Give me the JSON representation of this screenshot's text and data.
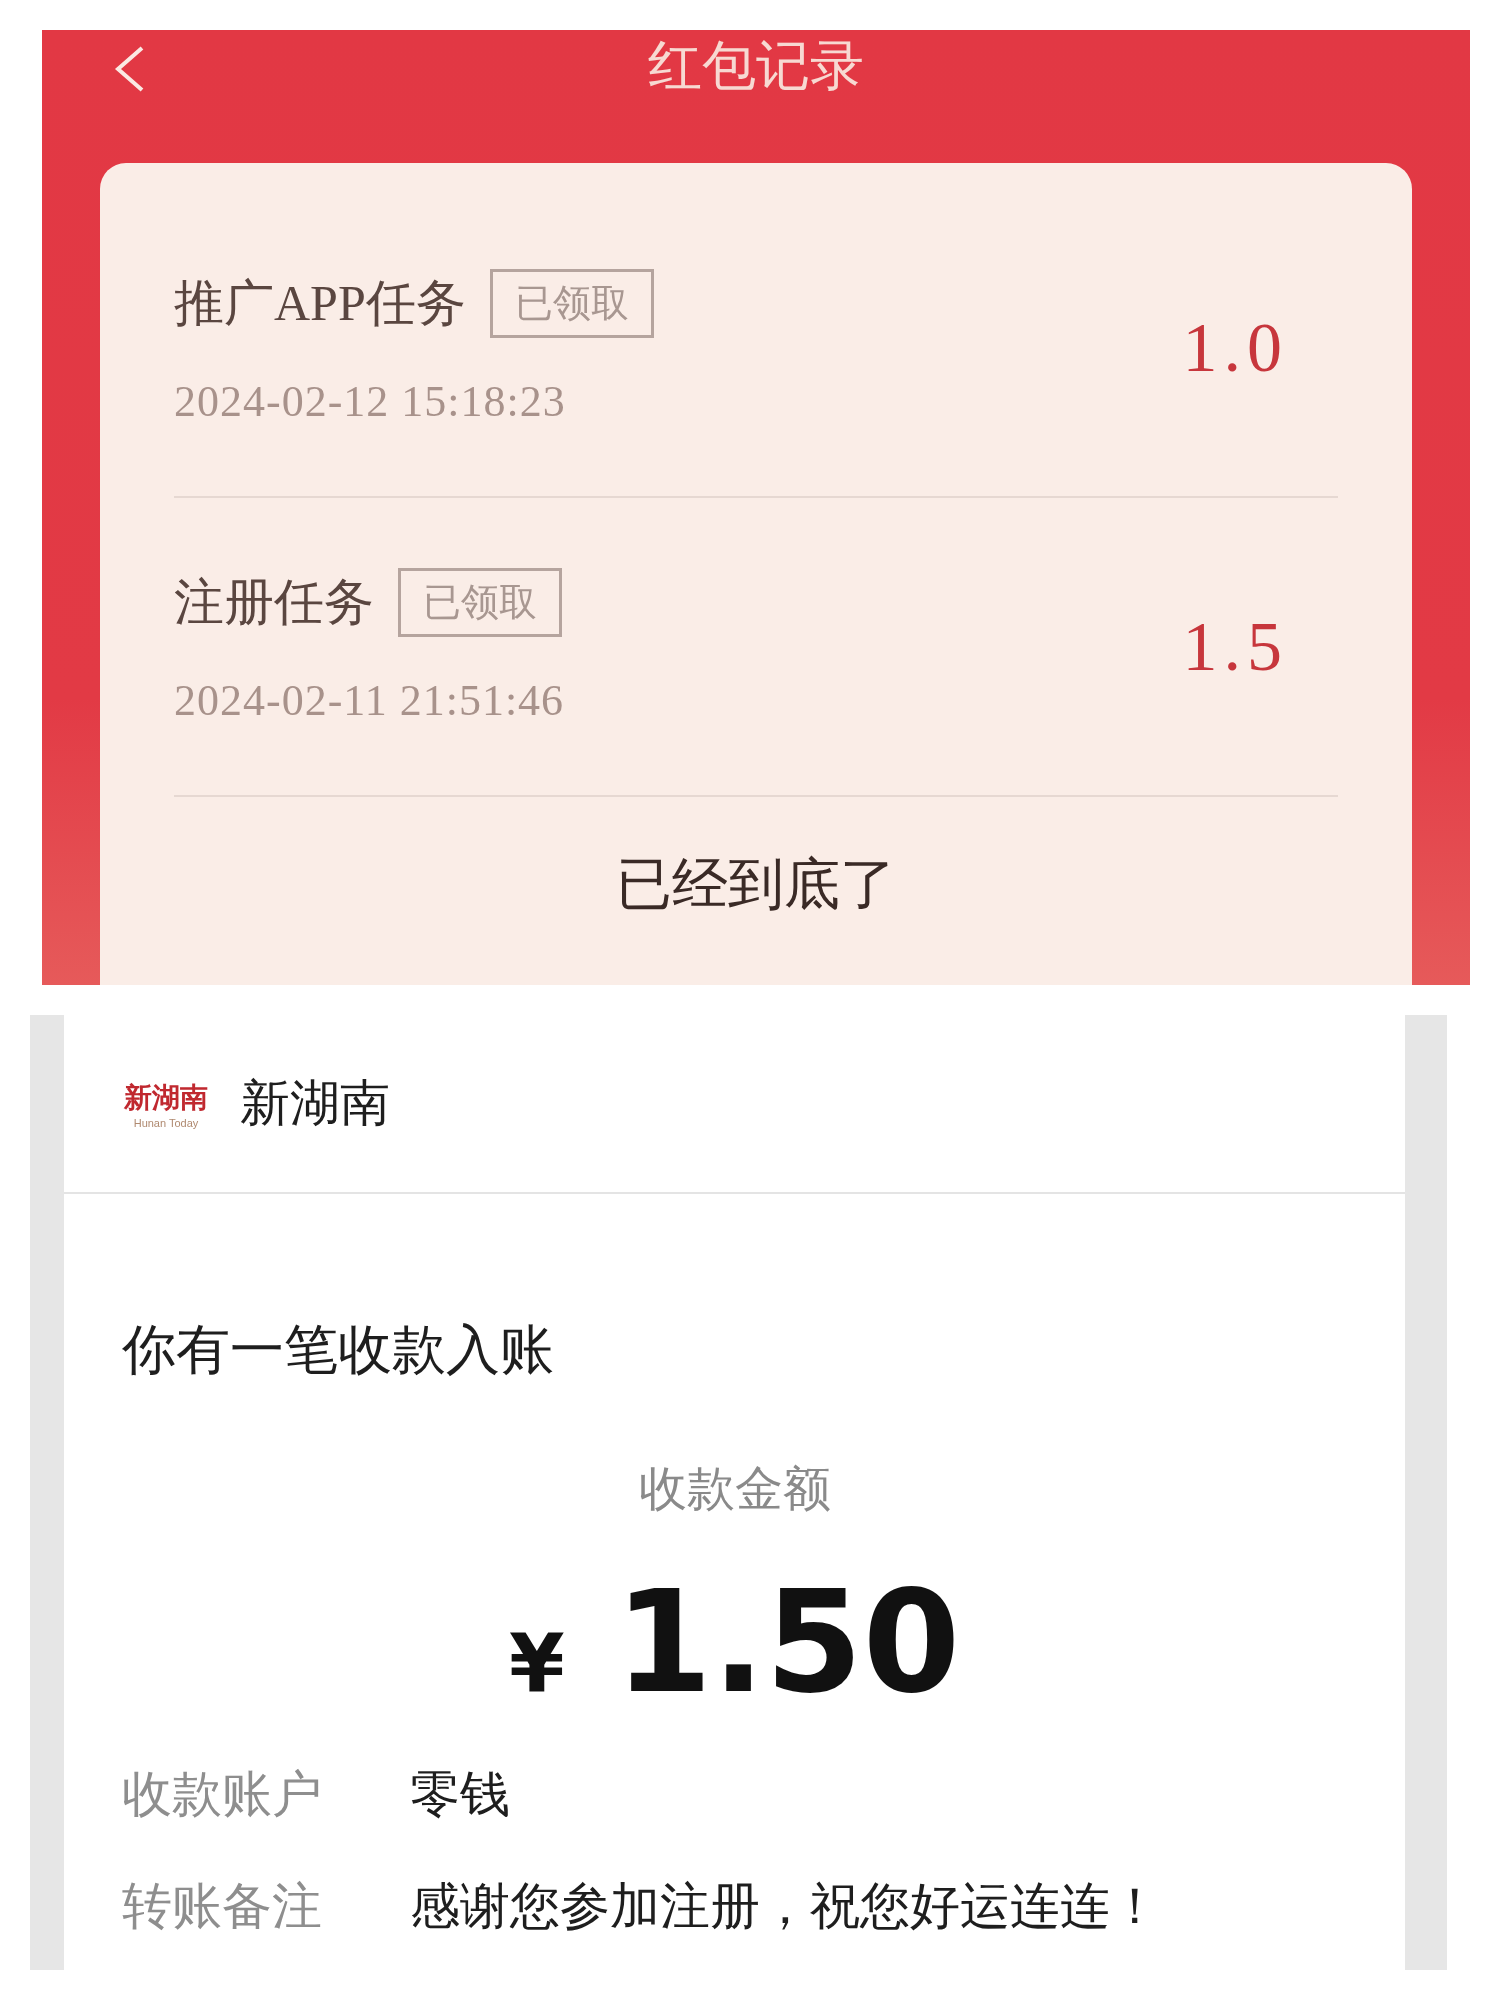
{
  "record_screen": {
    "title": "红包记录",
    "records": [
      {
        "task": "推广APP任务",
        "status": "已领取",
        "time": "2024-02-12  15:18:23",
        "amount": "1.0"
      },
      {
        "task": "注册任务",
        "status": "已领取",
        "time": "2024-02-11  21:51:46",
        "amount": "1.5"
      }
    ],
    "end_note": "已经到底了"
  },
  "payment_notice": {
    "logo_text": "新湖南",
    "logo_subtext": "Hunan Today",
    "sender": "新湖南",
    "headline": "你有一笔收款入账",
    "amount_label": "收款金额",
    "currency": "¥",
    "amount": "1.50",
    "details": [
      {
        "label": "收款账户",
        "value": "零钱"
      },
      {
        "label": "转账备注",
        "value": "感谢您参加注册，祝您好运连连！"
      }
    ]
  }
}
